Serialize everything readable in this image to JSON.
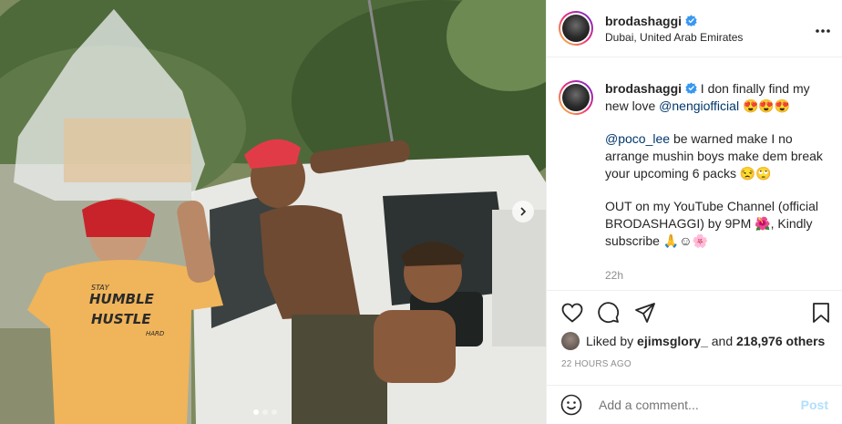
{
  "post": {
    "username": "brodashaggi",
    "location": "Dubai, United Arab Emirates",
    "more_icon": "more-horizontal-icon"
  },
  "caption": {
    "username": "brodashaggi",
    "line1_text": "I don finally find my new love",
    "line1_mention": "@nengiofficial",
    "line1_emoji": "😍😍😍",
    "line2_mention": "@poco_lee",
    "line2_text": "be warned make I no arrange mushin boys make dem break your upcoming 6 packs",
    "line2_emoji": "😒🙄",
    "line3_text": "OUT on my YouTube Channel (official BRODASHAGGI) by 9PM",
    "line3_emoji1": "🌺",
    "line3_text2": ", Kindly subscribe",
    "line3_emoji2": "🙏☺🌸",
    "time": "22h"
  },
  "photo_shirt": {
    "line1": "STAY",
    "line2": "HUMBLE",
    "line3": "HUSTLE",
    "line4": "HARD"
  },
  "likes": {
    "prefix": "Liked by",
    "user": "ejimsglory_",
    "and": "and",
    "count": "218,976 others"
  },
  "posted_ago": "22 HOURS AGO",
  "comment": {
    "placeholder": "Add a comment...",
    "post_label": "Post"
  },
  "colors": {
    "link": "#00376b",
    "verified": "#3897f0",
    "post_disabled": "#b2dffc"
  }
}
